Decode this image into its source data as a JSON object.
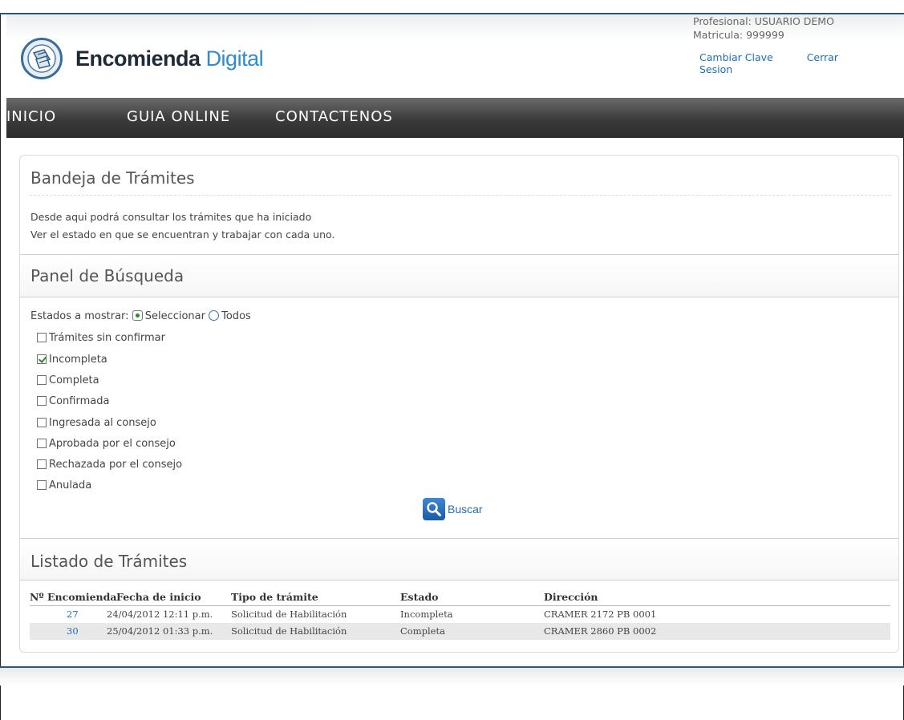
{
  "header": {
    "brand_part1": "Encomienda",
    "brand_part2": "Digital",
    "user_label": "Profesional: USUARIO DEMO",
    "matricula_label": "Matricula: 999999",
    "change_password": "Cambiar Clave",
    "logout": "Cerrar Sesion"
  },
  "nav": {
    "items": [
      "INICIO",
      "GUIA ONLINE",
      "CONTACTENOS"
    ]
  },
  "bandeja": {
    "title": "Bandeja de Trámites",
    "line1": "Desde aqui podrá consultar los trámites que ha iniciado",
    "line2": "Ver el estado en que se encuentran y trabajar con cada uno."
  },
  "busqueda": {
    "title": "Panel de Búsqueda",
    "estados_label": "Estados a mostrar:",
    "radio_select": "Seleccionar",
    "radio_all": "Todos",
    "states": [
      {
        "label": "Trámites sin confirmar",
        "checked": false
      },
      {
        "label": "Incompleta",
        "checked": true
      },
      {
        "label": "Completa",
        "checked": false
      },
      {
        "label": "Confirmada",
        "checked": false
      },
      {
        "label": "Ingresada al consejo",
        "checked": false
      },
      {
        "label": "Aprobada por el consejo",
        "checked": false
      },
      {
        "label": "Rechazada por el consejo",
        "checked": false
      },
      {
        "label": "Anulada",
        "checked": false
      }
    ],
    "search_button": "Buscar"
  },
  "listado": {
    "title": "Listado de Trámites",
    "columns": [
      "Nº Encomienda",
      "Fecha de inicio",
      "Tipo de trámite",
      "Estado",
      "Dirección"
    ],
    "rows": [
      [
        "27",
        "24/04/2012 12:11 p.m.",
        "Solicitud de Habilitación",
        "Incompleta",
        "CRAMER 2172 PB 0001"
      ],
      [
        "30",
        "25/04/2012 01:33 p.m.",
        "Solicitud de Habilitación",
        "Completa",
        "CRAMER 2860 PB 0002"
      ]
    ]
  },
  "colors": {
    "accent_blue": "#2f8bcb",
    "link_blue": "#1f6fb3",
    "nav_dark": "#3a3a3a"
  }
}
